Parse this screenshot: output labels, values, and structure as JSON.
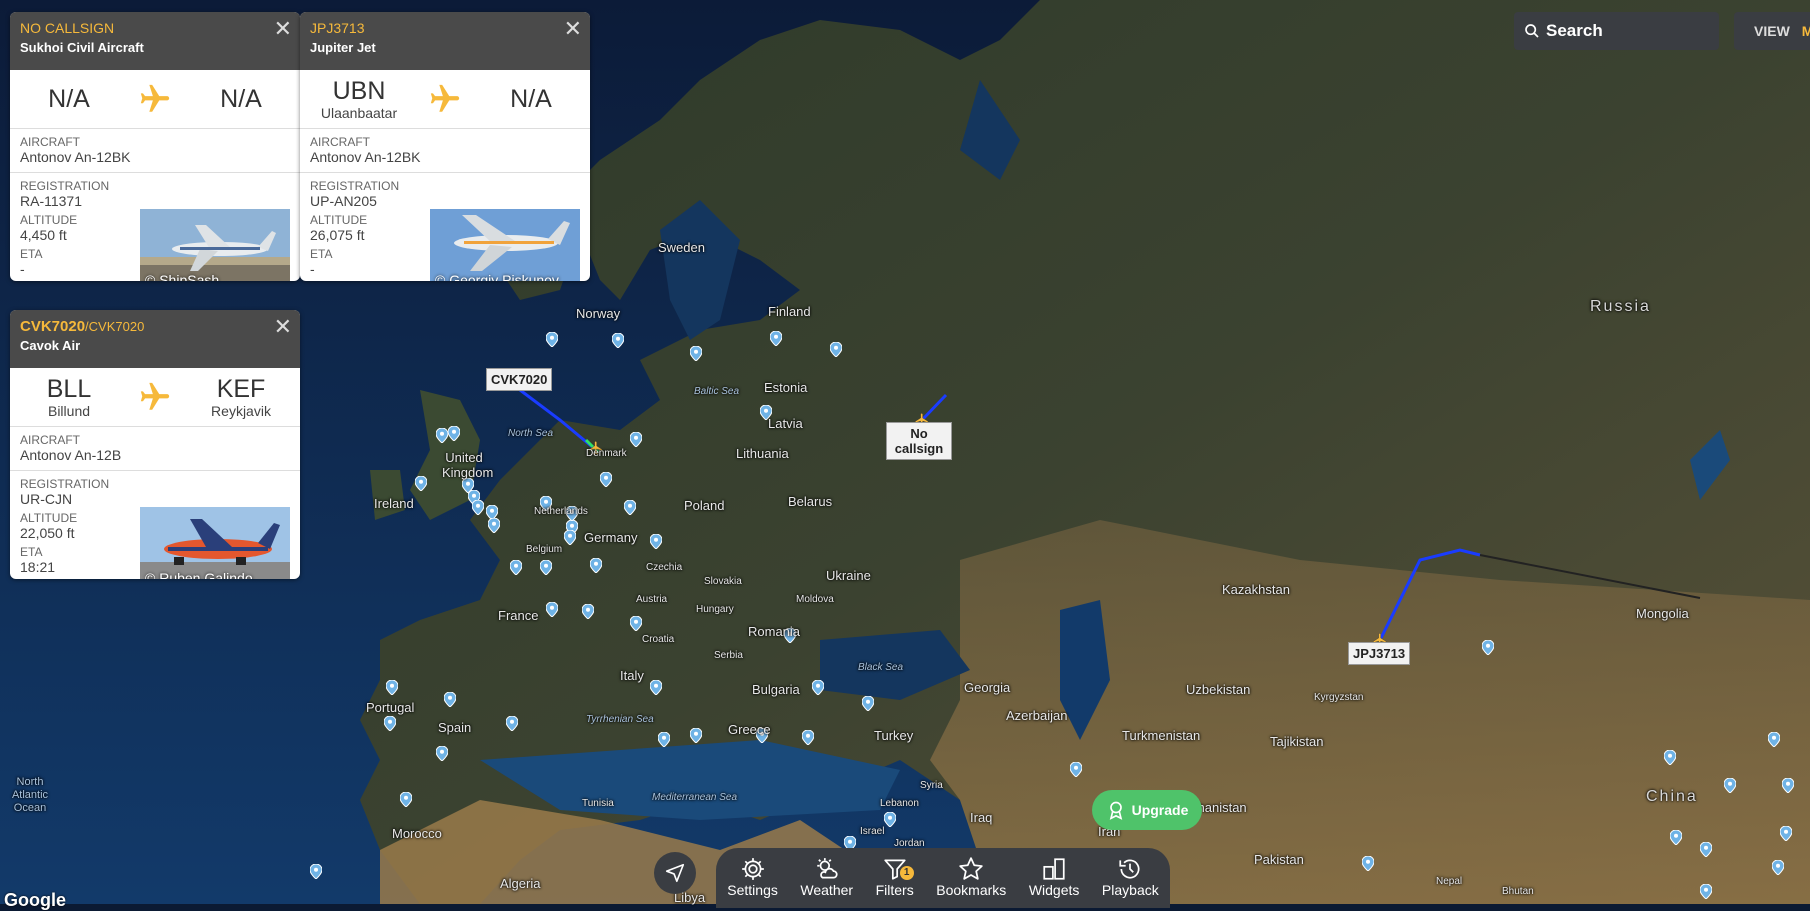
{
  "cards": [
    {
      "callsign_main": "",
      "callsign_sub": "NO CALLSIGN",
      "airline": "Sukhoi Civil Aircraft",
      "origin_code": "N/A",
      "origin_city": "",
      "dest_code": "N/A",
      "dest_city": "",
      "aircraft_label": "AIRCRAFT",
      "aircraft": "Antonov An-12BK",
      "registration_label": "REGISTRATION",
      "registration": "RA-11371",
      "altitude_label": "ALTITUDE",
      "altitude": "4,450 ft",
      "eta_label": "ETA",
      "eta": "-",
      "photo_credit": "© ShipSash"
    },
    {
      "callsign_main": "",
      "callsign_sub": "JPJ3713",
      "airline": "Jupiter Jet",
      "origin_code": "UBN",
      "origin_city": "Ulaanbaatar",
      "dest_code": "N/A",
      "dest_city": "",
      "aircraft_label": "AIRCRAFT",
      "aircraft": "Antonov An-12BK",
      "registration_label": "REGISTRATION",
      "registration": "UP-AN205",
      "altitude_label": "ALTITUDE",
      "altitude": "26,075 ft",
      "eta_label": "ETA",
      "eta": "-",
      "photo_credit": "© Georgiy Piskunov"
    },
    {
      "callsign_main": "CVK7020",
      "callsign_sub": "/CVK7020",
      "airline": "Cavok Air",
      "origin_code": "BLL",
      "origin_city": "Billund",
      "dest_code": "KEF",
      "dest_city": "Reykjavik",
      "aircraft_label": "AIRCRAFT",
      "aircraft": "Antonov An-12B",
      "registration_label": "REGISTRATION",
      "registration": "UR-CJN",
      "altitude_label": "ALTITUDE",
      "altitude": "22,050 ft",
      "eta_label": "ETA",
      "eta": "18:21",
      "photo_credit": "© Ruben Galindo"
    }
  ],
  "map": {
    "flight_tags": {
      "cvk": "CVK7020",
      "nocall": "No callsign",
      "jpj": "JPJ3713"
    },
    "labels": {
      "russia": "Russia",
      "sweden": "Sweden",
      "norway": "Norway",
      "finland": "Finland",
      "estonia": "Estonia",
      "latvia": "Latvia",
      "lithuania": "Lithuania",
      "belarus": "Belarus",
      "poland": "Poland",
      "ukraine": "Ukraine",
      "moldova": "Moldova",
      "romania": "Romania",
      "uk": "United Kingdom",
      "ireland": "Ireland",
      "denmark": "Denmark",
      "netherlands": "Netherlands",
      "belgium": "Belgium",
      "germany": "Germany",
      "czechia": "Czechia",
      "slovakia": "Slovakia",
      "austria": "Austria",
      "hungary": "Hungary",
      "croatia": "Croatia",
      "serbia": "Serbia",
      "france": "France",
      "italy": "Italy",
      "bulgaria": "Bulgaria",
      "greece": "Greece",
      "turkey": "Turkey",
      "georgia": "Georgia",
      "azerbaijan": "Azerbaijan",
      "kazakhstan": "Kazakhstan",
      "uzbekistan": "Uzbekistan",
      "turkmenistan": "Turkmenistan",
      "kyrgyzstan": "Kyrgyzstan",
      "tajikistan": "Tajikistan",
      "mongolia": "Mongolia",
      "china": "China",
      "afghanistan": "Afghanistan",
      "pakistan": "Pakistan",
      "iran": "Iran",
      "iraq": "Iraq",
      "syria": "Syria",
      "lebanon": "Lebanon",
      "israel": "Israel",
      "jordan": "Jordan",
      "nepal": "Nepal",
      "bhutan": "Bhutan",
      "portugal": "Portugal",
      "spain": "Spain",
      "morocco": "Morocco",
      "algeria": "Algeria",
      "tunisia": "Tunisia",
      "libya": "Libya",
      "north_sea": "North Sea",
      "baltic_sea": "Baltic Sea",
      "black_sea": "Black Sea",
      "tyrrhenian_sea": "Tyrrhenian Sea",
      "mediterranean_sea": "Mediterranean Sea",
      "north_atlantic_1": "North",
      "north_atlantic_2": "Atlantic",
      "north_atlantic_3": "Ocean"
    }
  },
  "search": {
    "label": "Search"
  },
  "view": {
    "label": "VIEW",
    "extra": "M"
  },
  "upgrade": {
    "label": "Upgrade"
  },
  "toolbar": {
    "settings": "Settings",
    "weather": "Weather",
    "filters": "Filters",
    "filters_badge": "1",
    "bookmarks": "Bookmarks",
    "widgets": "Widgets",
    "playback": "Playback"
  },
  "attribution": "Google",
  "colors": {
    "accent": "#f6b93b",
    "card_header": "#4a4a4a",
    "toolbar": "#3a3d42",
    "upgrade": "#4fc36a",
    "track": "#1a3cff"
  }
}
